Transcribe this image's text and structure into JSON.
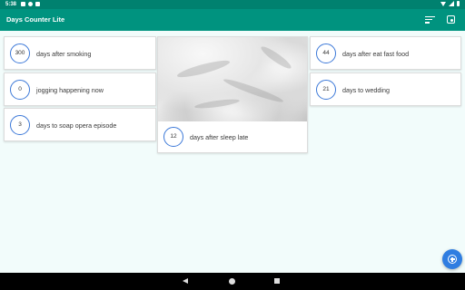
{
  "status_bar": {
    "time": "5:38"
  },
  "app_bar": {
    "title": "Days Counter Lite",
    "sort_icon": "sort-icon",
    "settings_icon": "settings-icon"
  },
  "counters": [
    {
      "count": "300",
      "label": "days after smoking"
    },
    {
      "count": "0",
      "label": "jogging happening now"
    },
    {
      "count": "3",
      "label": "days to soap opera episode"
    },
    {
      "count": "12",
      "label": "days after sleep late",
      "image": "bed-sheets-photo"
    },
    {
      "count": "44",
      "label": "days after eat fast food"
    },
    {
      "count": "21",
      "label": "days to wedding"
    }
  ],
  "fab": {
    "icon": "add-circle-icon"
  },
  "colors": {
    "app_bar": "#00937f",
    "status_bar": "#00816f",
    "accent": "#2f7de1",
    "background": "#f2fcfb"
  }
}
